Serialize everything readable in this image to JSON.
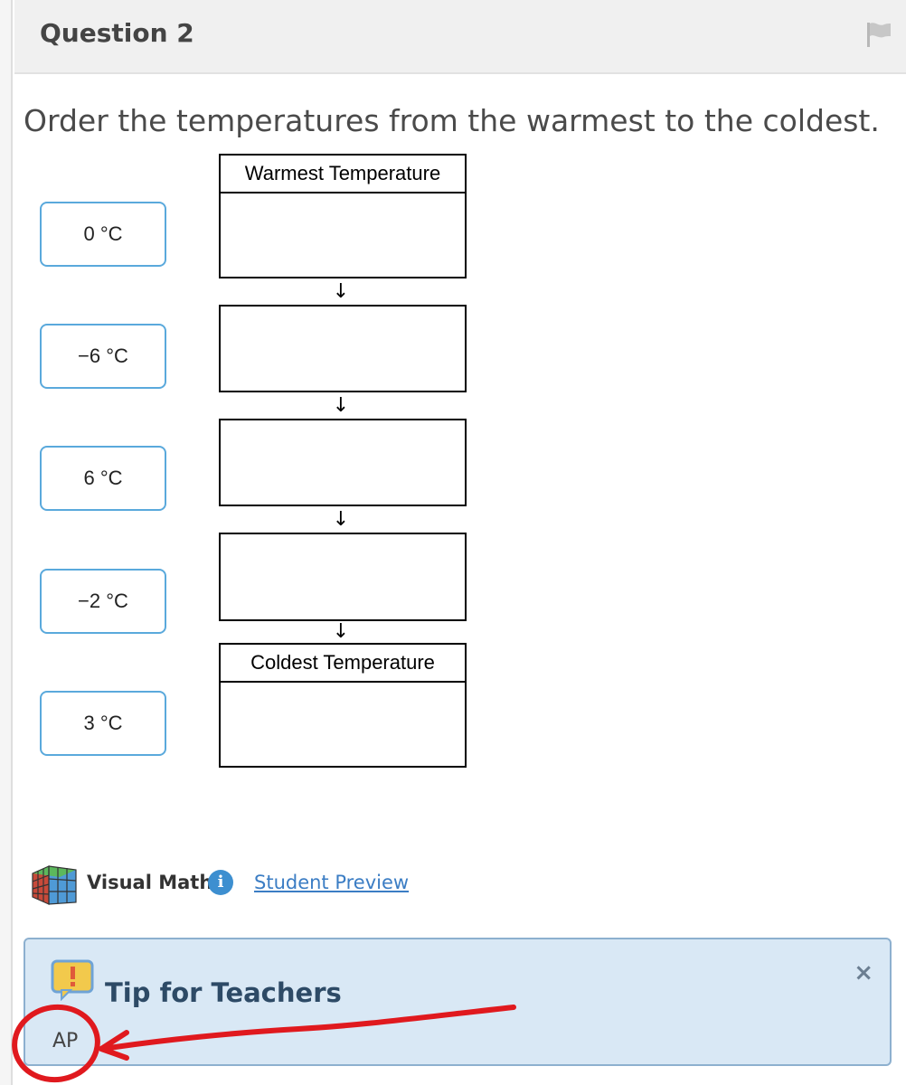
{
  "header": {
    "title": "Question 2",
    "flag_icon": "flag-icon"
  },
  "question": {
    "prompt": "Order the temperatures from the warmest to the coldest."
  },
  "tiles": [
    "0 °C",
    "−6 °C",
    "6 °C",
    "−2 °C",
    "3 °C"
  ],
  "slots": {
    "top_label": "Warmest Temperature",
    "bottom_label": "Coldest Temperature",
    "arrow": "↓"
  },
  "footer": {
    "visual_math_label": "Visual Math",
    "info_icon_glyph": "i",
    "student_preview_link": "Student Preview"
  },
  "tip": {
    "title": "Tip for Teachers",
    "close_glyph": "×",
    "text": "AP"
  },
  "colors": {
    "tile_border": "#5aa9dc",
    "tip_background": "#d9e8f5",
    "annotation": "#e0191e",
    "link": "#3b7dc4"
  }
}
